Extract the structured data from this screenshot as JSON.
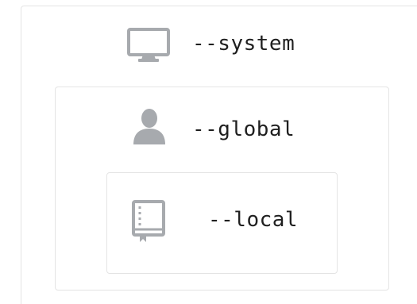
{
  "colors": {
    "icon": "#a7aaae",
    "text": "#1f1f1f",
    "border": "#e4e4e4",
    "background": "#ffffff"
  },
  "levels": [
    {
      "key": "system",
      "label": "--system",
      "icon": "desktop-monitor-icon"
    },
    {
      "key": "global",
      "label": "--global",
      "icon": "person-icon"
    },
    {
      "key": "local",
      "label": "--local",
      "icon": "repository-book-icon"
    }
  ]
}
